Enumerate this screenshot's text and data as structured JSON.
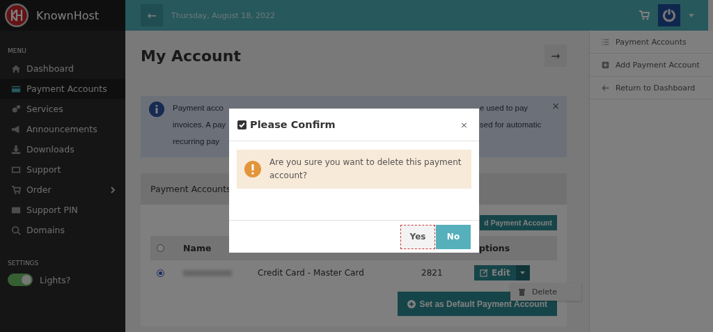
{
  "brand": {
    "name": "KnownHost"
  },
  "sidebar": {
    "menu_label": "MENU",
    "items": [
      {
        "label": "Dashboard",
        "selected": false,
        "submenu": false
      },
      {
        "label": "Payment Accounts",
        "selected": true,
        "submenu": false
      },
      {
        "label": "Services",
        "selected": false,
        "submenu": false
      },
      {
        "label": "Announcements",
        "selected": false,
        "submenu": false
      },
      {
        "label": "Downloads",
        "selected": false,
        "submenu": false
      },
      {
        "label": "Support",
        "selected": false,
        "submenu": false
      },
      {
        "label": "Order",
        "selected": false,
        "submenu": true
      },
      {
        "label": "Support PIN",
        "selected": false,
        "submenu": false
      },
      {
        "label": "Domains",
        "selected": false,
        "submenu": false
      }
    ],
    "settings_label": "SETTINGS",
    "toggle": {
      "label": "Lights?",
      "on": true
    }
  },
  "topbar": {
    "back": "←",
    "date": "Thursday, August 18, 2022"
  },
  "page": {
    "title": "My Account",
    "forward": "→"
  },
  "alert": {
    "lines": [
      {
        "left": "Payment acco",
        "right": "e used to pay"
      },
      {
        "left": "invoices. A pay",
        "right": "sed for automatic"
      },
      {
        "left": "recurring pay"
      }
    ],
    "close": "×"
  },
  "card": {
    "title": "Payment Accounts",
    "add_button": "d Payment Account",
    "select_all": {
      "checked": false
    },
    "columns": [
      {
        "label": "Name"
      },
      {
        "label": "ptions"
      }
    ],
    "rows": [
      {
        "selected": true,
        "type": "Credit Card - Master Card",
        "last4": "2821",
        "edit": "Edit"
      }
    ],
    "dropdown": [
      "Delete"
    ],
    "default_button": "Set as Default Payment Account"
  },
  "right_nav": {
    "items": [
      {
        "label": "Payment Accounts"
      },
      {
        "label": "Add Payment Account"
      },
      {
        "label": "Return to Dashboard"
      }
    ]
  },
  "modal": {
    "title": "Please Confirm",
    "close": "×",
    "message": "Are you sure you want to delete this payment account?",
    "buttons": [
      {
        "label": "Yes",
        "kind": "default",
        "focused": true
      },
      {
        "label": "No",
        "kind": "primary",
        "focused": false
      }
    ]
  }
}
